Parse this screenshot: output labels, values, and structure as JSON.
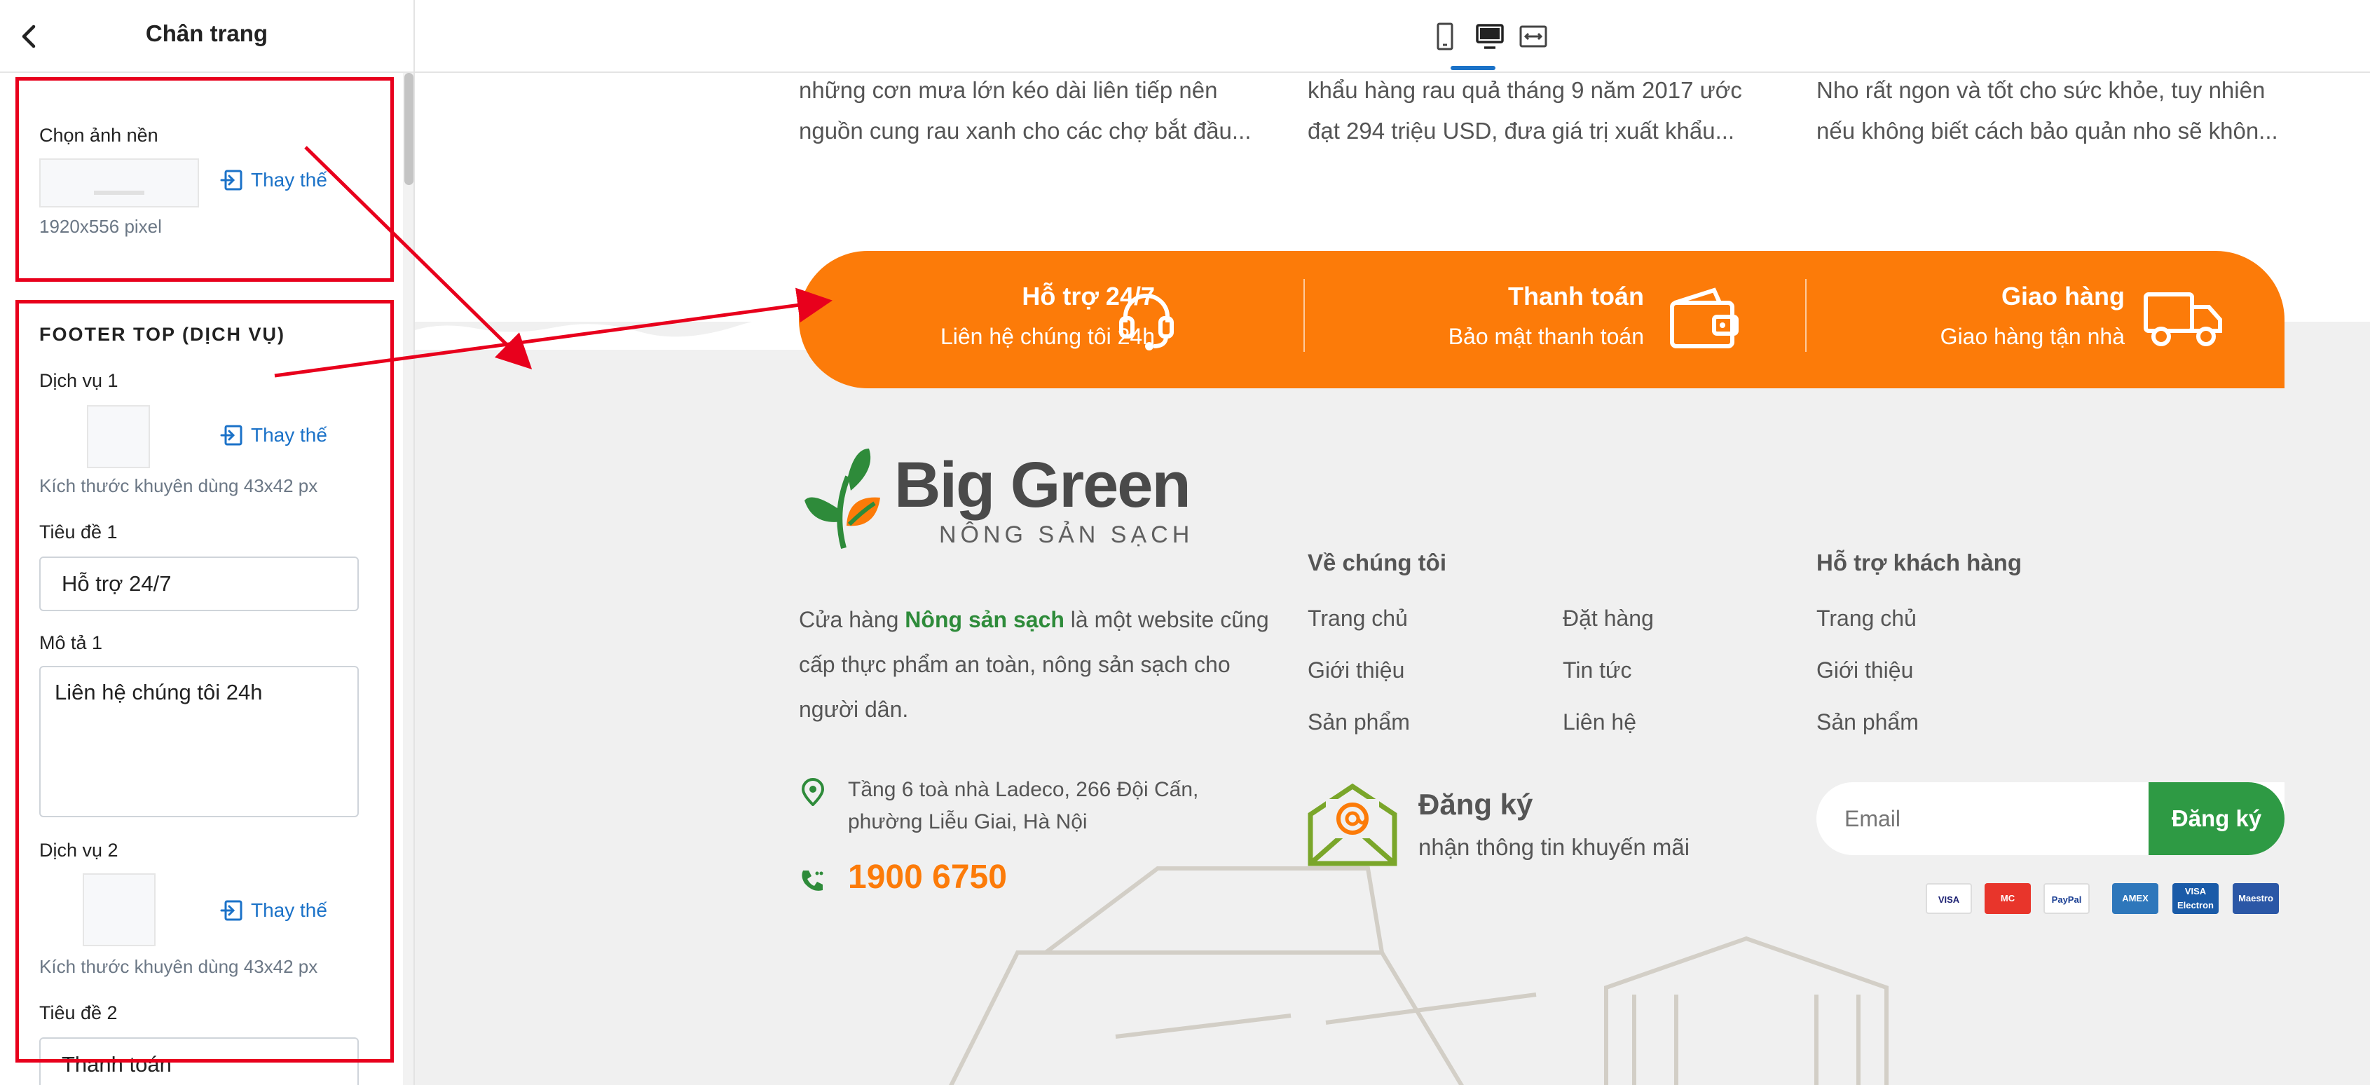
{
  "panel": {
    "title": "Chân trang",
    "bg_label": "Chọn ảnh nền",
    "replace_label": "Thay thế",
    "bg_size": "1920x556 pixel",
    "section_title": "FOOTER TOP (DỊCH VỤ)",
    "service1_label": "Dịch vụ 1",
    "service1_note": "Kích thước khuyên dùng 43x42 px",
    "title1_label": "Tiêu đề 1",
    "title1_value": "Hỗ trợ 24/7",
    "desc1_label": "Mô tả 1",
    "desc1_value": "Liên hệ chúng tôi 24h",
    "service2_label": "Dịch vụ 2",
    "service2_note": "Kích thước khuyên dùng 43x42 px",
    "title2_label": "Tiêu đề 2",
    "title2_value": "Thanh toán"
  },
  "toolbar": {
    "devices": [
      "mobile-icon",
      "desktop-icon",
      "fullwidth-icon"
    ],
    "active": "desktop-icon"
  },
  "preview": {
    "news": [
      {
        "line1": "những cơn mưa lớn kéo dài liên tiếp nên",
        "line2": "nguồn cung rau xanh cho các chợ bắt đầu..."
      },
      {
        "line1": "khẩu hàng rau quả tháng 9 năm 2017 ước",
        "line2": "đạt 294 triệu USD, đưa giá trị xuất khẩu..."
      },
      {
        "line1": "Nho rất ngon và tốt cho sức khỏe, tuy nhiên",
        "line2": "nếu không biết cách bảo quản nho sẽ khôn..."
      }
    ],
    "services": [
      {
        "title": "Hỗ trợ 24/7",
        "desc": "Liên hệ chúng tôi 24h",
        "icon": "headset-icon"
      },
      {
        "title": "Thanh toán",
        "desc": "Bảo mật thanh toán",
        "icon": "wallet-icon"
      },
      {
        "title": "Giao hàng",
        "desc": "Giao hàng tận nhà",
        "icon": "truck-icon"
      }
    ],
    "logo": {
      "title": "Big Green",
      "subtitle": "NÔNG SẢN SẠCH"
    },
    "about": {
      "prefix": "Cửa hàng ",
      "highlight": "Nông sản sạch",
      "suffix": " là một website cũng cấp thực phẩm an toàn, nông sản sạch cho người dân."
    },
    "address": "Tầng 6 toà nhà Ladeco, 266 Đội Cấn, phường Liễu Giai, Hà Nội",
    "phone": "1900 6750",
    "about_us": {
      "title": "Về chúng tôi",
      "links": [
        "Trang chủ",
        "Giới thiệu",
        "Sản phẩm",
        "Đặt hàng",
        "Tin tức",
        "Liên hệ"
      ]
    },
    "support": {
      "title": "Hỗ trợ khách hàng",
      "links": [
        "Trang chủ",
        "Giới thiệu",
        "Sản phẩm"
      ]
    },
    "subscribe": {
      "title": "Đăng ký",
      "subtitle": "nhận thông tin khuyến mãi",
      "placeholder": "Email",
      "button": "Đăng ký"
    },
    "payments": [
      {
        "name": "VISA",
        "color": "#ffffff",
        "text": "#1a1f71"
      },
      {
        "name": "MC",
        "color": "#e8352b",
        "text": "#ffffff"
      },
      {
        "name": "PayPal",
        "color": "#ffffff",
        "text": "#1b3f93"
      },
      {
        "name": "AMEX",
        "color": "#2e77bb",
        "text": "#ffffff"
      },
      {
        "name": "VISA Electron",
        "color": "#1a5ba8",
        "text": "#ffffff"
      },
      {
        "name": "Maestro",
        "color": "#2b57a6",
        "text": "#ffffff"
      }
    ]
  },
  "colors": {
    "accent_orange": "#fc7b09",
    "brand_green": "#2e9a44",
    "highlight_red": "#e8001c",
    "link_blue": "#1b72c8"
  }
}
